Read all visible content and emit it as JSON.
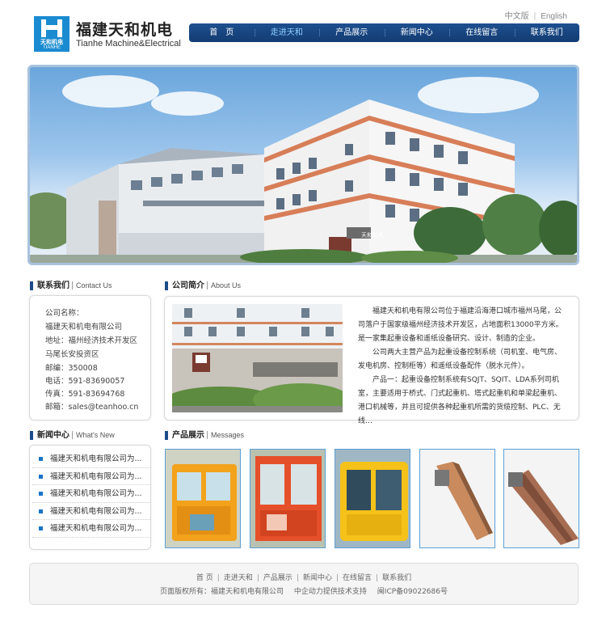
{
  "header": {
    "logo_cn": "天和机电",
    "logo_en": "TIANHE",
    "brand_cn": "福建天和机电",
    "brand_en": "Tianhe Machine&Electrical",
    "lang": [
      "中文版",
      "English"
    ]
  },
  "nav": {
    "items": [
      "首　页",
      "走进天和",
      "产品展示",
      "新闻中心",
      "在线留言",
      "联系我们"
    ],
    "active_index": 1
  },
  "banner": {
    "building_sign": "天和机电"
  },
  "contact": {
    "title": "联系我们",
    "title_en": "Contact Us",
    "lines": [
      "公司名称：",
      "福建天和机电有限公司",
      "地址：福州经济技术开发区",
      "马尾长安投资区",
      "邮编：350008",
      "电话：591-83690057",
      "传真：591-83694768",
      "邮箱：sales@teanhoo.cn"
    ]
  },
  "about": {
    "title": "公司简介",
    "title_en": "About Us",
    "paragraphs": [
      "福建天和机电有限公司位于福建沿海港口城市福州马尾，公司落户于国家级福州经济技术开发区，占地面积13000平方米。是一家集起重设备和遥纸设备研究、设计、制造的企业。",
      "公司两大主营产品为起重设备控制系统（司机室、电气房、发电机房、控制柜等）和遥纸设备配件（脱水元件）。",
      "产品一：起重设备控制系统有SQJT、SQIT、LDA系列司机室，主要适用于桥式、门式起重机、塔式起重机和单梁起重机、港口机械等，并且可提供各种起重机所需的货缆控制、PLC、无线…"
    ]
  },
  "news": {
    "title": "新闻中心",
    "title_en": "What's New",
    "items": [
      "福建天和机电有限公司为...",
      "福建天和机电有限公司为...",
      "福建天和机电有限公司为...",
      "福建天和机电有限公司为...",
      "福建天和机电有限公司为..."
    ]
  },
  "products": {
    "title": "产品展示",
    "title_en": "Messages",
    "items": [
      {
        "name": "cabin-yellow",
        "color": "#f2a21b"
      },
      {
        "name": "cabin-red",
        "color": "#e5502a"
      },
      {
        "name": "cabin-yellow-large",
        "color": "#f5c21a"
      },
      {
        "name": "dewatering-element",
        "color": "#c98a5e"
      },
      {
        "name": "dewatering-plate",
        "color": "#a76d53"
      }
    ]
  },
  "footer": {
    "links": [
      "首 页",
      "走进天和",
      "产品展示",
      "新闻中心",
      "在线留言",
      "联系我们"
    ],
    "copyright": "页面版权所有：福建天和机电有限公司",
    "support": "中企动力提供技术支持",
    "icp": "闽ICP备09022686号"
  },
  "colors": {
    "nav_bg": "#1a4a87",
    "accent_blue": "#1a74c8",
    "section_marker": "#1c4b8a"
  }
}
